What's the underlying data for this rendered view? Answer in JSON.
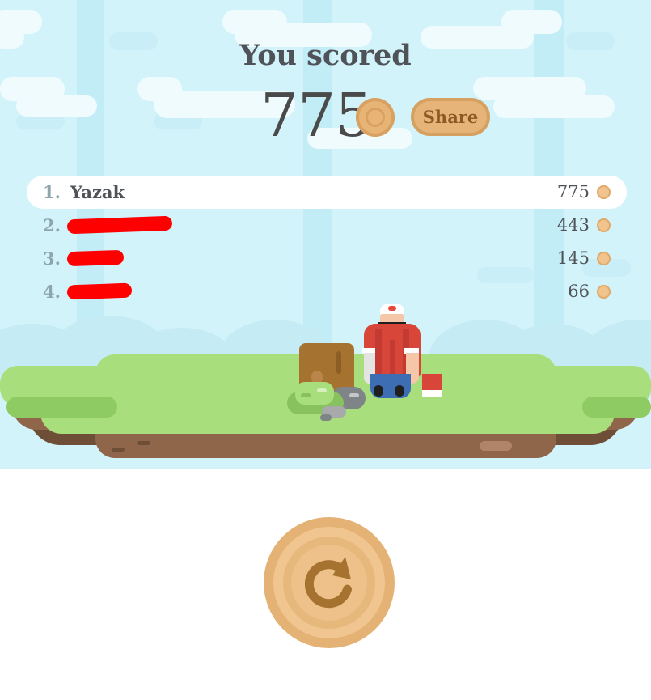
{
  "result": {
    "title": "You scored",
    "score": "775",
    "share_label": "Share"
  },
  "leaderboard": [
    {
      "rank": "1.",
      "name": "Yazak",
      "score": "775",
      "highlighted": true
    },
    {
      "rank": "2.",
      "name": "",
      "score": "443",
      "redacted": true
    },
    {
      "rank": "3.",
      "name": "",
      "score": "145",
      "redacted": true
    },
    {
      "rank": "4.",
      "name": "",
      "score": "66",
      "redacted": true
    }
  ],
  "icons": {
    "coin": "coin-icon",
    "restart": "restart-icon",
    "share": "share-button"
  },
  "colors": {
    "sky": "#d3f3fb",
    "wood": "#e3b274",
    "wood_dark": "#a5722f",
    "grass": "#a8de7c",
    "dirt": "#8f6649",
    "text": "#4f5357",
    "redaction": "#ff0000"
  }
}
